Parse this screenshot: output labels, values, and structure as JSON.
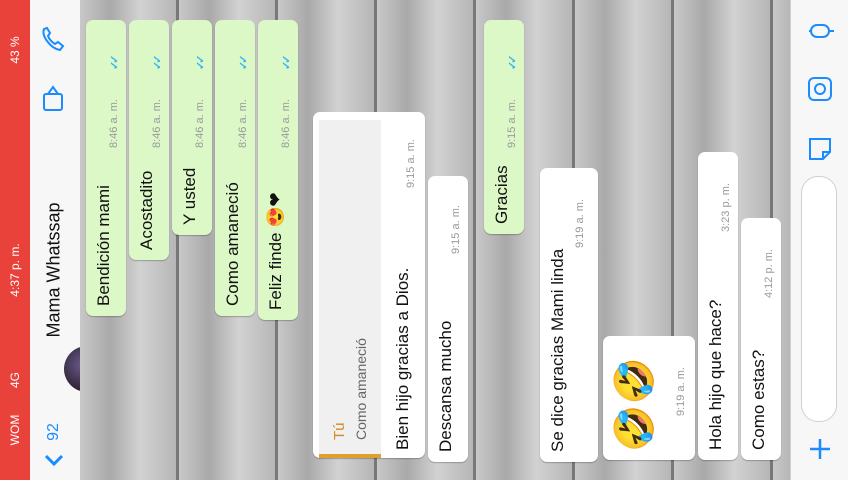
{
  "status_bar": {
    "time": "4:37 p. m.",
    "carrier": "WOM",
    "network": "4G",
    "battery": "43 %"
  },
  "header": {
    "back_count": "92",
    "contact_name": "Mama Whatssap"
  },
  "messages": [
    {
      "text": "Bendición mami",
      "time": "8:46 a. m."
    },
    {
      "text": "Acostadito",
      "time": "8:46 a. m."
    },
    {
      "text": "Y usted",
      "time": "8:46 a. m."
    },
    {
      "text": "Como amaneció",
      "time": "8:46 a. m."
    },
    {
      "text": "Feliz finde",
      "emoji": "😍❤",
      "time": "8:46 a. m."
    },
    {
      "reply_author": "Tú",
      "reply_text": "Como amaneció",
      "text": "Bien hijo gracias a Dios.",
      "time": "9:15 a. m."
    },
    {
      "text": "Descansa mucho",
      "time": "9:15 a. m."
    },
    {
      "text": "Gracias",
      "time": "9:15 a. m."
    },
    {
      "text": "Se dice gracias Mami linda",
      "time": "9:19 a. m."
    },
    {
      "emoji": "🤣🤣",
      "time": "9:19 a. m."
    },
    {
      "text": "Hola hijo que hace?",
      "time": "3:23 p. m."
    },
    {
      "text": "Como estas?",
      "time": "4:12 p. m."
    }
  ],
  "colors": {
    "status_bar": "#e8423b",
    "outgoing_bubble": "#dcf8c6",
    "incoming_bubble": "#ffffff",
    "accent": "#1a8cff"
  },
  "icons": [
    "phone-icon",
    "video-call-icon",
    "back-chevron-icon",
    "microphone-icon",
    "camera-icon",
    "sticker-icon",
    "plus-icon"
  ]
}
